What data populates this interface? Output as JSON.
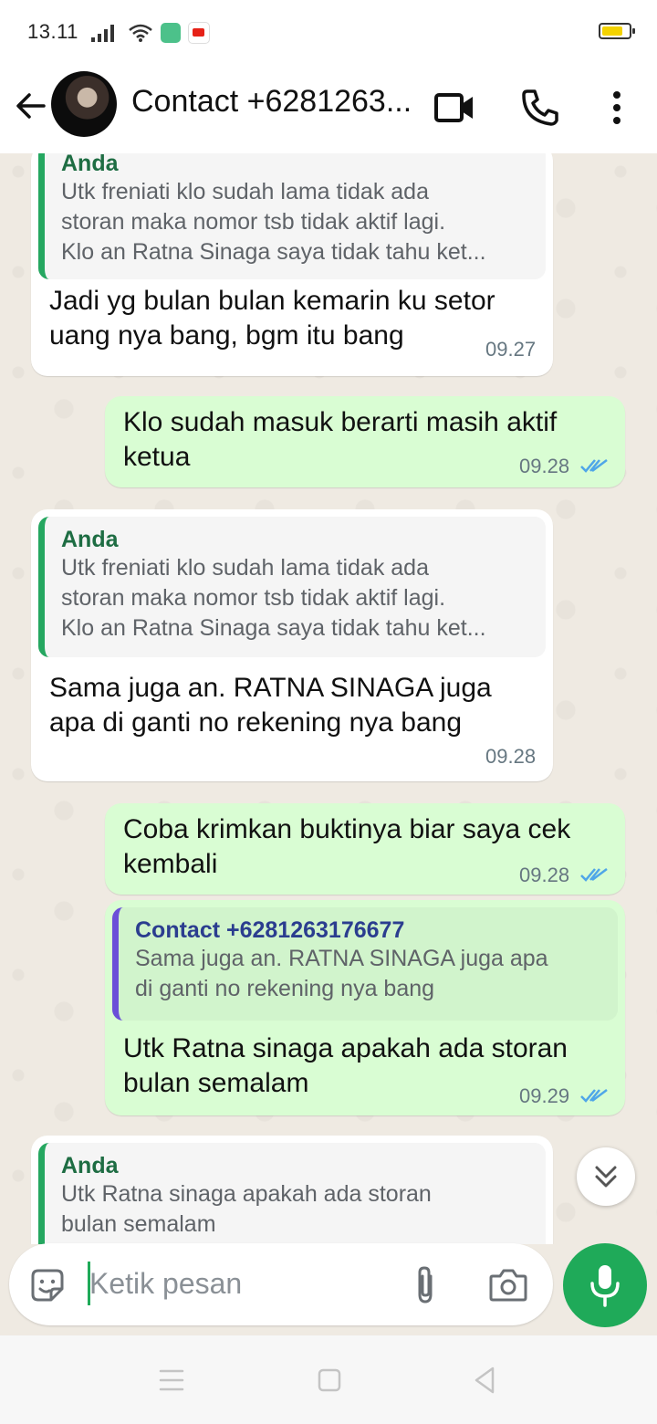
{
  "status": {
    "time": "13.11"
  },
  "header": {
    "contact_name": "Contact +6281263..."
  },
  "messages": [
    {
      "type": "in",
      "quote_name": "Anda",
      "quote_text": [
        "Utk freniati klo sudah lama tidak ada",
        "storan maka nomor tsb tidak aktif lagi.",
        "Klo an Ratna Sinaga saya tidak tahu ket..."
      ],
      "text": [
        "Jadi yg bulan bulan kemarin ku setor",
        "uang nya bang, bgm itu bang"
      ],
      "time": "09.27"
    },
    {
      "type": "out",
      "text": [
        "Klo sudah masuk berarti masih aktif",
        "ketua"
      ],
      "time": "09.28"
    },
    {
      "type": "in",
      "quote_name": "Anda",
      "quote_text": [
        "Utk freniati klo sudah lama tidak ada",
        "storan maka nomor tsb tidak aktif lagi.",
        "Klo an Ratna Sinaga saya tidak tahu ket..."
      ],
      "text": [
        "Sama juga an. RATNA SINAGA juga",
        "apa di ganti no rekening nya bang"
      ],
      "time": "09.28"
    },
    {
      "type": "out",
      "text": [
        "Coba krimkan buktinya biar saya cek",
        "kembali"
      ],
      "time": "09.28"
    },
    {
      "type": "out",
      "quote_name": "Contact +6281263176677",
      "quote_text": [
        "Sama juga an. RATNA SINAGA juga apa",
        "di ganti no rekening nya bang"
      ],
      "text": [
        "Utk Ratna sinaga apakah ada storan",
        "bulan semalam"
      ],
      "time": "09.29"
    },
    {
      "type": "in",
      "quote_name": "Anda",
      "quote_text": [
        "Utk Ratna sinaga apakah ada storan",
        "bulan semalam"
      ]
    }
  ],
  "input": {
    "placeholder": "Ketik pesan"
  },
  "icons": {
    "back": "arrow-left-icon",
    "video": "video-call-icon",
    "call": "phone-icon",
    "menu": "more-vertical-icon",
    "sticker": "sticker-icon",
    "attach": "paperclip-icon",
    "camera": "camera-icon",
    "mic": "microphone-icon",
    "scroll": "double-chevron-down-icon"
  },
  "colors": {
    "outgoing": "#d9fdd3",
    "incoming": "#ffffff",
    "accent": "#1faa59",
    "read_ticks": "#4fa6e8"
  }
}
